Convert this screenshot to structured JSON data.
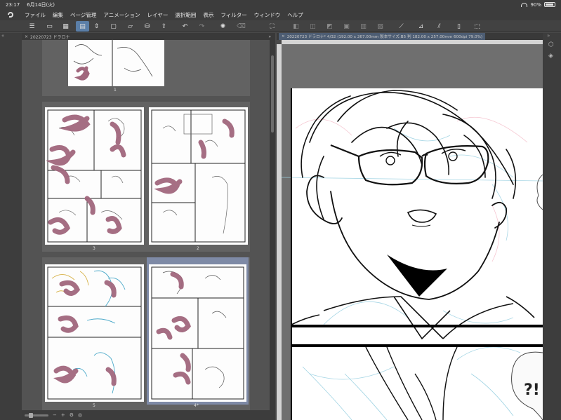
{
  "status": {
    "time": "23:17",
    "date": "6月14日(火)",
    "battery": "90%",
    "battery_level": 0.9
  },
  "menu": {
    "items": [
      "ファイル",
      "編集",
      "ページ管理",
      "アニメーション",
      "レイヤー",
      "選択範囲",
      "表示",
      "フィルター",
      "ウィンドウ",
      "ヘルプ"
    ]
  },
  "left_panel": {
    "tab_title": "20220723 ドラロナ",
    "pages": [
      {
        "label": "1"
      },
      {
        "label": "3"
      },
      {
        "label": "2"
      },
      {
        "label": "5"
      },
      {
        "label": "4*",
        "selected": true
      }
    ]
  },
  "canvas": {
    "tab_title": "20220723 ドラロナ* 4/32 (192.00 x 267.00mm 製本サイズ:B5 判 182.00 x 257.00mm 600dpi 79.0%)",
    "sfx_text": "?!"
  },
  "colors": {
    "scribble": "#a1677d",
    "selection": "#7e8aa6",
    "canvas_bg": "#6f6f6f"
  }
}
